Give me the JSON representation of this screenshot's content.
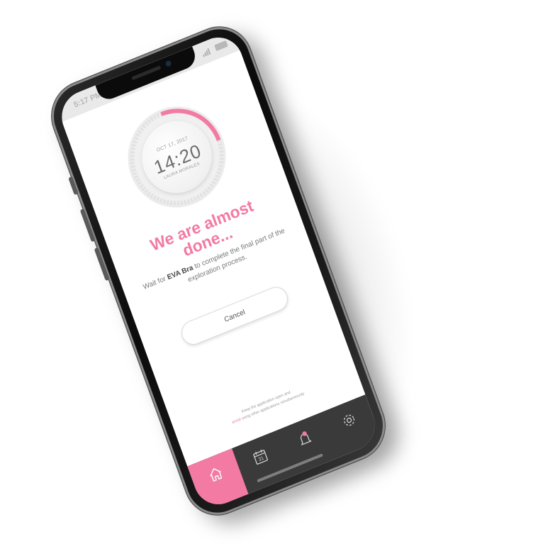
{
  "status_bar": {
    "time": "5:17 PM"
  },
  "clock": {
    "date": "OCT 17, 2017",
    "time": "14:20",
    "user_name": "LAURA MORALES",
    "progress": 0.25
  },
  "headline": {
    "line1": "We are almost",
    "line2": "done..."
  },
  "subtext": {
    "prefix": "Wait for ",
    "product": "EVA Bra",
    "suffix": " to complete the final part of the exploration process."
  },
  "cancel_button": {
    "label": "Cancel"
  },
  "footnote": {
    "line1": "Keep the application open and",
    "avoid": "avoid",
    "line2_rest": " using other applications simultaneously"
  },
  "tabbar": {
    "tabs": [
      {
        "id": "home",
        "icon": "home-icon",
        "active": true
      },
      {
        "id": "calendar",
        "icon": "calendar-icon",
        "label": "31",
        "active": false
      },
      {
        "id": "alerts",
        "icon": "bell-icon",
        "active": false
      },
      {
        "id": "settings",
        "icon": "gear-icon",
        "active": false
      }
    ]
  },
  "colors": {
    "accent": "#f27aa3",
    "tabbar_bg": "#3a3a3a",
    "text_gray": "#7a7a7a"
  }
}
